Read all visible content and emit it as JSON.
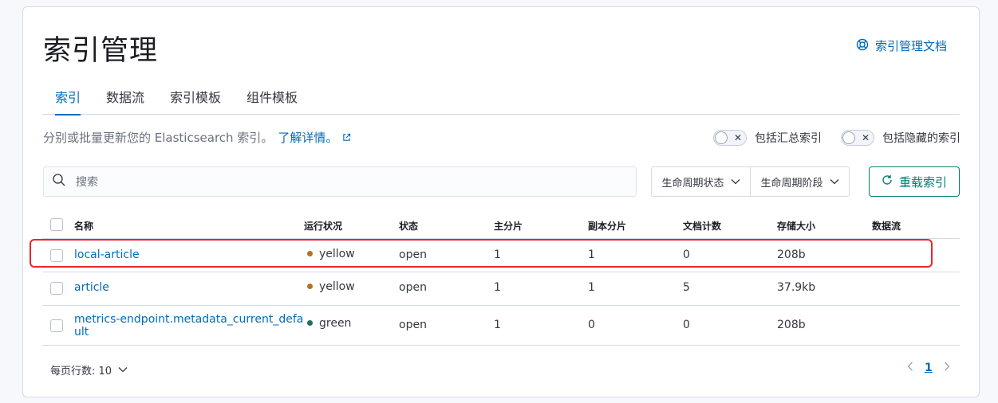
{
  "page": {
    "title": "索引管理",
    "doc_link": "索引管理文档"
  },
  "tabs": [
    {
      "label": "索引",
      "active": true
    },
    {
      "label": "数据流",
      "active": false
    },
    {
      "label": "索引模板",
      "active": false
    },
    {
      "label": "组件模板",
      "active": false
    }
  ],
  "description": {
    "text": "分别或批量更新您的 Elasticsearch 索引。",
    "link": "了解详情。"
  },
  "toggles": {
    "include_rollup": "包括汇总索引",
    "include_hidden": "包括隐藏的索引"
  },
  "search": {
    "placeholder": "搜索"
  },
  "filters": {
    "lifecycle_status": "生命周期状态",
    "lifecycle_phase": "生命周期阶段"
  },
  "reload_button": "重载索引",
  "table": {
    "columns": [
      "名称",
      "运行状况",
      "状态",
      "主分片",
      "副本分片",
      "文档计数",
      "存储大小",
      "数据流"
    ],
    "rows": [
      {
        "name": "local-article",
        "health": "yellow",
        "health_color": "#b0761d",
        "status": "open",
        "primary": "1",
        "replicas": "1",
        "docs": "0",
        "size": "208b",
        "data_stream": ""
      },
      {
        "name": "article",
        "health": "yellow",
        "health_color": "#b0761d",
        "status": "open",
        "primary": "1",
        "replicas": "1",
        "docs": "5",
        "size": "37.9kb",
        "data_stream": ""
      },
      {
        "name_line1": "metrics-endpoint.metadata_current_defa",
        "name_line2": "ult",
        "health": "green",
        "health_color": "#1f6f63",
        "status": "open",
        "primary": "1",
        "replicas": "0",
        "docs": "0",
        "size": "208b",
        "data_stream": ""
      }
    ]
  },
  "pagination": {
    "rows_per_page": "每页行数: 10",
    "current_page": "1"
  },
  "colors": {
    "accent": "#006bb8",
    "success": "#017d73",
    "highlight_box": "#e8262b"
  }
}
